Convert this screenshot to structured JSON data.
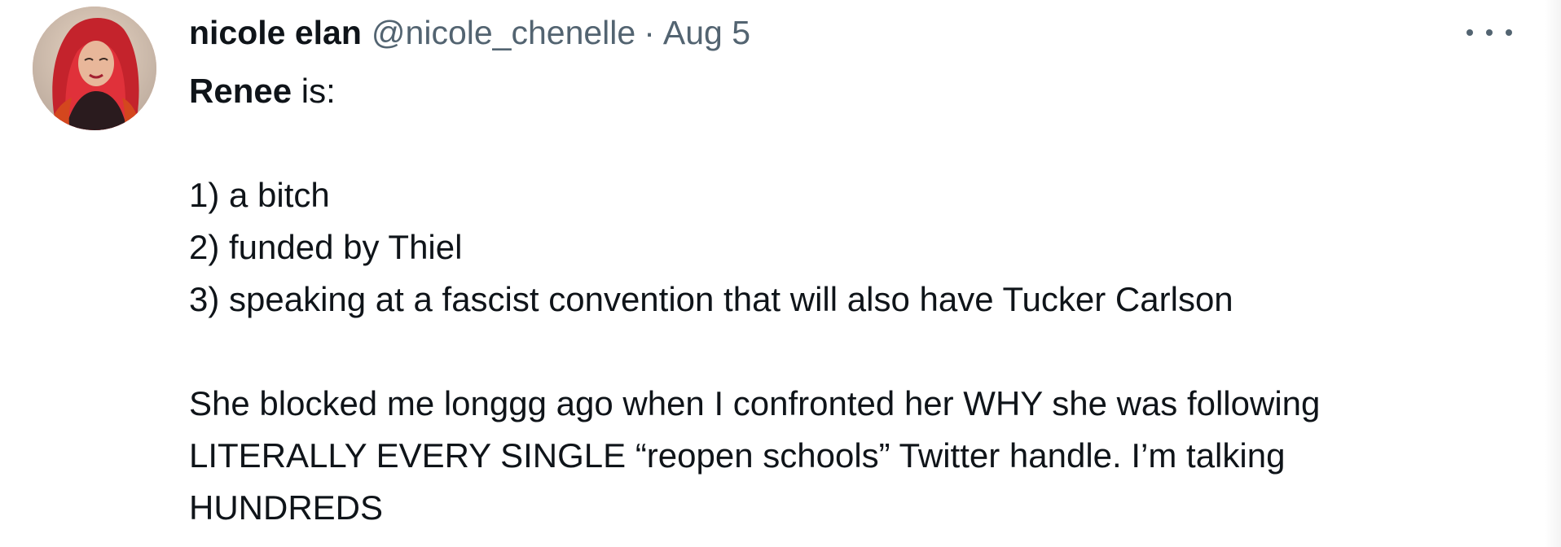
{
  "tweet": {
    "author": {
      "display_name": "nicole elan",
      "handle": "@nicole_chenelle",
      "avatar_icon": "profile-photo"
    },
    "separator": "·",
    "date": "Aug 5",
    "more_icon": "ellipsis-icon",
    "text": {
      "line1_bold": "Renee",
      "line1_rest": " is:",
      "list": [
        "1) a bitch",
        "2) funded by Thiel",
        "3) speaking at a fascist convention that will also have Tucker Carlson"
      ],
      "paragraph": [
        "She blocked me longgg ago when I confronted her WHY she was following",
        "LITERALLY EVERY SINGLE “reopen schools” Twitter handle. I’m talking",
        "HUNDREDS"
      ]
    }
  },
  "colors": {
    "primary_text": "#0f1419",
    "secondary_text": "#536471",
    "background": "#ffffff"
  }
}
